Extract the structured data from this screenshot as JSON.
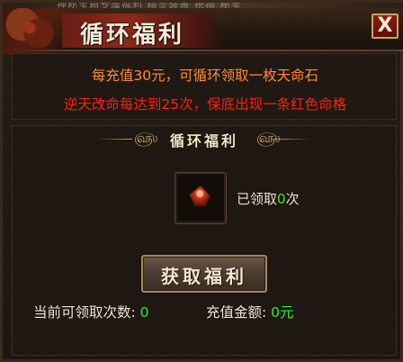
{
  "window": {
    "title": "循环福利",
    "close_label": "X",
    "background_text": "神秘宝箱专属福利  精灵装备  祝福  秘宝"
  },
  "info": {
    "line1": "每充值30元，可循环领取一枚天命石",
    "line2": "逆天改命每达到25次，保底出现一条红色命格"
  },
  "section": {
    "title": "循环福利",
    "left_ornament": "௵",
    "right_ornament": "௵"
  },
  "item": {
    "icon": "fate-stone-icon",
    "claimed_prefix": "已领取",
    "claimed_count": "0",
    "claimed_suffix": "次"
  },
  "claim_button": {
    "label": "获取福利"
  },
  "stats": {
    "times_label": "当前可领取次数:",
    "times_value": "0",
    "amount_label": "充值金额:",
    "amount_value": "0元"
  },
  "colors": {
    "orange_text": "#ff8a3a",
    "red_text": "#ff1f0f",
    "green_value": "#38e83a",
    "gold": "#c9a45a"
  }
}
